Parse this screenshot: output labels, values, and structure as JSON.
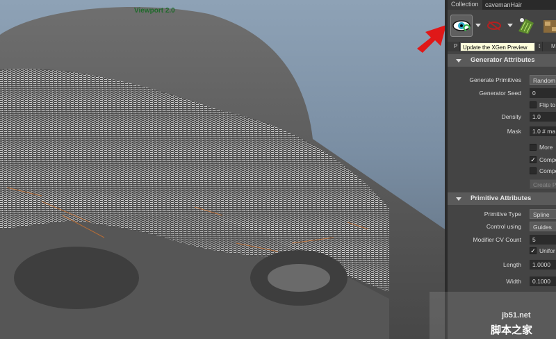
{
  "viewport": {
    "label": "Viewport 2.0"
  },
  "collection": {
    "label": "Collection",
    "value": "cavemanHair"
  },
  "tooltip": "Update the XGen Preview",
  "tabs": [
    "P",
    "t",
    "M"
  ],
  "sections": {
    "generator": {
      "title": "Generator Attributes",
      "generate_primitives": {
        "label": "Generate Primitives",
        "value": "Random"
      },
      "generator_seed": {
        "label": "Generator Seed",
        "value": "0"
      },
      "flip": {
        "label": "Flip to"
      },
      "density": {
        "label": "Density",
        "value": "1.0"
      },
      "mask": {
        "label": "Mask",
        "value": "1.0 # ma"
      },
      "more": {
        "label": "More"
      },
      "comp1": {
        "label": "Compo",
        "checked": true
      },
      "comp2": {
        "label": "Compe",
        "checked": false
      },
      "create_button": "Create Pa"
    },
    "primitive": {
      "title": "Primitive Attributes",
      "primitive_type": {
        "label": "Primitive Type",
        "value": "Spline"
      },
      "control_using": {
        "label": "Control using",
        "value": "Guides"
      },
      "modifier_cv": {
        "label": "Modifier CV Count",
        "value": "5"
      },
      "uniform": {
        "label": "Unifor",
        "checked": true
      },
      "length": {
        "label": "Length",
        "value": "1.0000"
      },
      "width": {
        "label": "Width",
        "value": "0.1000"
      }
    }
  },
  "watermark": {
    "site": "jb51.net",
    "brand": "脚本之家"
  },
  "colors": {
    "accent_arrow": "#e01818",
    "viewport_label": "#1e6a2a"
  },
  "icons": [
    "eye-refresh-icon",
    "eye-disabled-icon",
    "grass-preview-icon",
    "texture-icon",
    "red-arrow-icon"
  ]
}
